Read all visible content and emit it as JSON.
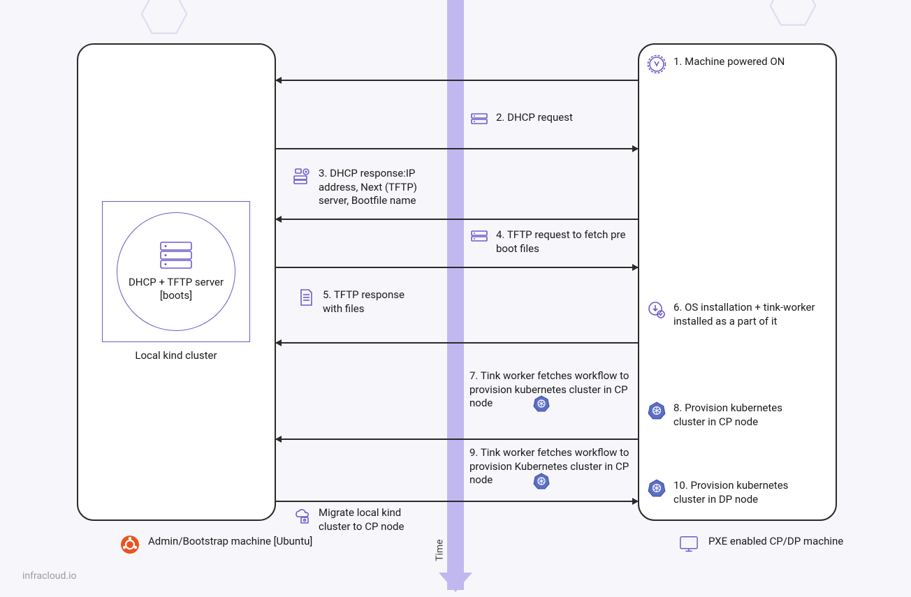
{
  "left": {
    "server_label": "DHCP + TFTP server [boots]",
    "cluster_label": "Local kind cluster",
    "bottom_label": "Admin/Bootstrap machine [Ubuntu]"
  },
  "right": {
    "bottom_label": "PXE enabled CP/DP machine"
  },
  "steps": {
    "s1": "1. Machine powered ON",
    "s2": "2. DHCP request",
    "s3": "3. DHCP response:IP address, Next (TFTP) server, Bootfile name",
    "s4": "4. TFTP request to fetch pre boot files",
    "s5": "5. TFTP response with files",
    "s6": "6. OS installation + tink-worker installed as a part of it",
    "s7": "7. Tink worker fetches workflow to provision kubernetes cluster in CP node",
    "s8": "8. Provision kubernetes cluster in CP node",
    "s9": "9. Tink worker fetches workflow to provision Kubernetes cluster in CP node",
    "s10": "10. Provision kubernetes cluster in DP node",
    "migrate": "Migrate local kind cluster to CP node"
  },
  "time_label": "Time",
  "watermark": "infracloud.io"
}
